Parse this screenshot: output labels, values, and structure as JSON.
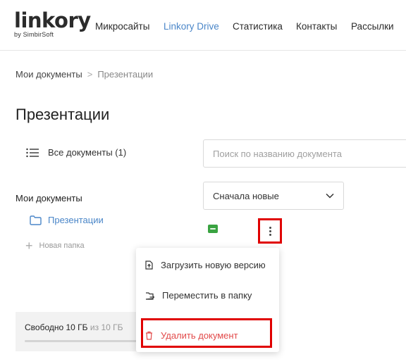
{
  "header": {
    "logo_word": "linkory",
    "logo_sub": "by SimbirSoft",
    "nav": [
      {
        "label": "Микросайты",
        "active": false
      },
      {
        "label": "Linkory Drive",
        "active": true
      },
      {
        "label": "Статистика",
        "active": false
      },
      {
        "label": "Контакты",
        "active": false
      },
      {
        "label": "Рассылки",
        "active": false
      }
    ]
  },
  "breadcrumb": {
    "root": "Мои документы",
    "separator": ">",
    "current": "Презентации"
  },
  "page_title": "Презентации",
  "sidebar": {
    "all_documents": "Все документы (1)",
    "my_documents": "Мои документы",
    "folder": "Презентации",
    "new_folder": "Новая папка",
    "new_folder_symbol": "+"
  },
  "search": {
    "placeholder": "Поиск по названию документа"
  },
  "sort": {
    "value": "Сначала новые"
  },
  "storage": {
    "free_label": "Свободно 10 ГБ",
    "total_label": "из 10 ГБ",
    "used_fraction": 0.0
  },
  "context_menu": {
    "upload_version": "Загрузить новую версию",
    "move_to_folder": "Переместить в папку",
    "delete_document": "Удалить документ"
  },
  "colors": {
    "accent": "#4a86c8",
    "danger": "#e24a4a",
    "highlight": "#e00000",
    "file_green": "#3aa341"
  }
}
